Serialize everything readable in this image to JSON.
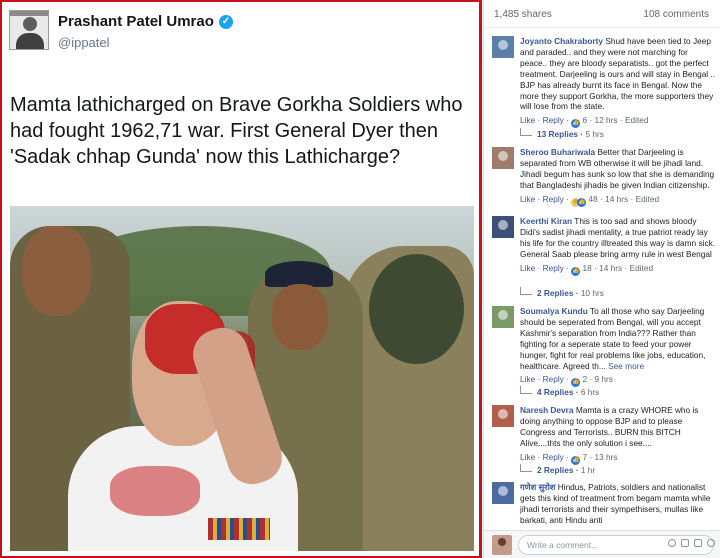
{
  "tweet": {
    "name": "Prashant Patel Umrao",
    "handle": "@ippatel",
    "verified_symbol": "✓",
    "text": "Mamta lathicharged on Brave Gorkha Soldiers who had fought 1962,71 war. First General Dyer then 'Sadak chhap Gunda' now this Lathicharge?"
  },
  "comments_panel": {
    "shares": "1,485 shares",
    "comments_count": "108 comments",
    "like_label": "Like",
    "reply_label": "Reply",
    "comments": [
      {
        "author": "Joyanto Chakraborty",
        "text": "Shud have been tied to Jeep and paraded.. and they were not marching for peace.. they are bloody separatists.. got the perfect treatment. Darjeeling is ours and will stay in Bengal .. BJP has already burnt its face in Bengal. Now the more they support Gorkha, the more supporters they will lose from the state.",
        "reactions": "6",
        "age": "12 hrs",
        "edited": "Edited",
        "replies": "13 Replies",
        "replies_age": "5 hrs",
        "avatar_color": "#5b7fa8"
      },
      {
        "author": "Sheroo Buhariwala",
        "text": "Better that Darjeeling is separated from WB otherwise it will be jihadi land. Jihadi begum has sunk so low that she is demanding that Bangladeshi jihadis be given Indian citizenship.",
        "reactions": "48",
        "age": "14 hrs",
        "edited": "Edited",
        "avatar_color": "#a07a6a"
      },
      {
        "author": "Keerthi Kiran",
        "text": "This is too sad and shows bloody Didi's sadist jihadi mentality, a true patriot ready lay his life for the country illtreated this way is damn sick. General Saab please bring army rule in west Bengal",
        "reactions": "18",
        "age": "14 hrs",
        "edited": "Edited",
        "replies": "2 Replies",
        "replies_age": "10 hrs",
        "avatar_color": "#3c4f7a"
      },
      {
        "author": "Soumalya Kundu",
        "text": "To all those who say Darjeeling should be seperated from Bengal, will you accept Kashmir's separation from India??? Rather than fighting for a seperate state to feed your power hunger, fight for real problems like jobs, education, healthcare. Agreed th...",
        "see_more": "See more",
        "reactions": "2",
        "age": "9 hrs",
        "replies": "4 Replies",
        "replies_age": "6 hrs",
        "avatar_color": "#7a9a6a"
      },
      {
        "author": "Naresh Devra",
        "text": "Mamta is a crazy WHORE who is doing anything to oppose BJP and to please Congress and Terrorists.. BURN this BITCH Alive....thts the only solution i see....",
        "reactions": "7",
        "age": "13 hrs",
        "replies": "2 Replies",
        "replies_age": "1 hr",
        "avatar_color": "#b0604a"
      },
      {
        "author": "गणेश सुरोश",
        "text": "Hindus, Patriots, soldiers and nationalist gets this kind of treatment from begam mamta while jihadi terrorists and their sympethisers, mullas like barkati, anti Hindu anti",
        "avatar_color": "#4a6aa0"
      }
    ],
    "write_placeholder": "Write a comment..."
  }
}
